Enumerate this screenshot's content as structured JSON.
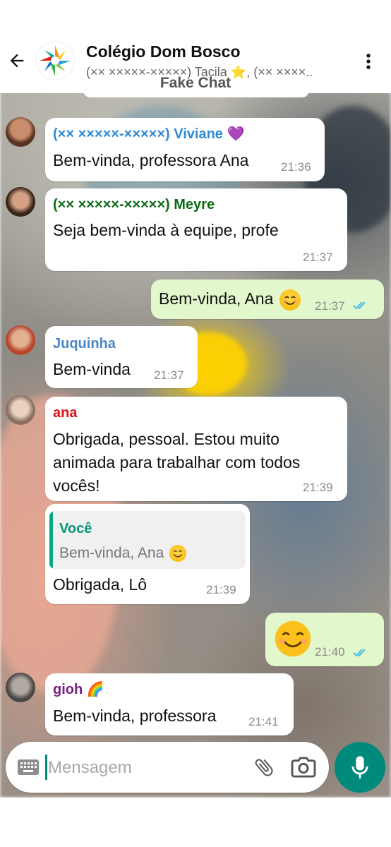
{
  "header": {
    "title": "Colégio Dom Bosco",
    "subtitle": "(×× ×××××-×××××) Tacila ⭐, (×× ××××..",
    "watermark": "Fake Chat"
  },
  "messages": [
    {
      "sender": "(×× ×××××-×××××) Viviane 💜",
      "sender_color": "#2e8bd6",
      "text": "Bem-vinda, professora Ana",
      "time": "21:36"
    },
    {
      "sender": "(×× ×××××-×××××) Meyre",
      "sender_color": "#0b6a14",
      "text": "Seja bem-vinda à equipe, profe",
      "time": "21:37"
    },
    {
      "text": "Bem-vinda, Ana",
      "time": "21:37",
      "direction": "outgoing"
    },
    {
      "sender": "Juquinha",
      "sender_color": "#4a86c5",
      "text": "Bem-vinda",
      "time": "21:37"
    },
    {
      "sender": "ana",
      "sender_color": "#d8141a",
      "text": "Obrigada, pessoal. Estou muito animada para trabalhar com todos vocês!",
      "time": "21:39"
    },
    {
      "quote_author": "Você",
      "quote_text": "Bem-vinda, Ana",
      "text": "Obrigada, Lô",
      "time": "21:39"
    },
    {
      "text": "😊",
      "time": "21:40",
      "direction": "outgoing"
    },
    {
      "sender": "gioh 🌈",
      "sender_color": "#7a1f86",
      "text": "Bem-vinda, professora",
      "time": "21:41"
    }
  ],
  "composer": {
    "placeholder": "Mensagem"
  },
  "colors": {
    "accent": "#008a7c",
    "outgoing_bubble": "#e2f7cb",
    "read_ticks": "#34b7f1"
  },
  "icons": [
    "back-arrow-icon",
    "more-vert-icon",
    "keyboard-icon",
    "attach-icon",
    "camera-icon",
    "mic-icon",
    "double-check-icon"
  ]
}
